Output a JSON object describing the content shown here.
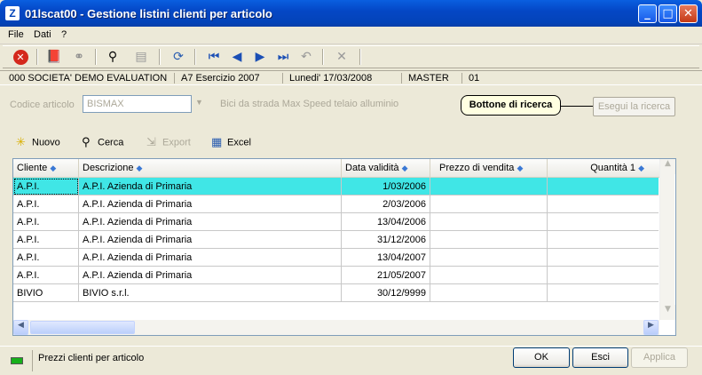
{
  "window": {
    "title": "01lscat00 - Gestione listini clienti per articolo",
    "app_icon_letter": "Z"
  },
  "menu": [
    {
      "label": "File"
    },
    {
      "label": "Dati"
    },
    {
      "label": "?"
    }
  ],
  "toolbar": {
    "icons": [
      "close-red-icon",
      "book-icon",
      "binoculars-icon",
      "find-icon",
      "paste-icon",
      "refresh-icon",
      "first-icon",
      "prev-icon",
      "next-icon",
      "last-icon",
      "undo-icon",
      "delete-icon"
    ]
  },
  "status": {
    "company": "000 SOCIETA' DEMO EVALUATION",
    "year": "A7 Esercizio 2007",
    "date": "Lunedi' 17/03/2008",
    "user": "MASTER",
    "code": "01"
  },
  "search": {
    "label": "Codice articolo",
    "value": "BISMAX",
    "description": "Bici da strada Max Speed telaio alluminio",
    "tooltip": "Bottone di ricerca",
    "button_label": "Esegui la ricerca"
  },
  "actions": {
    "new": "Nuovo",
    "find": "Cerca",
    "export": "Export",
    "excel": "Excel"
  },
  "table": {
    "columns": [
      "Cliente",
      "Descrizione",
      "Data validità",
      "Prezzo di vendita",
      "Quantità 1"
    ],
    "rows": [
      {
        "cliente": "A.P.I.",
        "descrizione": "A.P.I. Azienda di Primaria",
        "data": "1/03/2006",
        "prezzo": "",
        "quantita": ""
      },
      {
        "cliente": "A.P.I.",
        "descrizione": "A.P.I. Azienda di Primaria",
        "data": "2/03/2006",
        "prezzo": "",
        "quantita": ""
      },
      {
        "cliente": "A.P.I.",
        "descrizione": "A.P.I. Azienda di Primaria",
        "data": "13/04/2006",
        "prezzo": "",
        "quantita": ""
      },
      {
        "cliente": "A.P.I.",
        "descrizione": "A.P.I. Azienda di Primaria",
        "data": "31/12/2006",
        "prezzo": "",
        "quantita": ""
      },
      {
        "cliente": "A.P.I.",
        "descrizione": "A.P.I. Azienda di Primaria",
        "data": "13/04/2007",
        "prezzo": "",
        "quantita": ""
      },
      {
        "cliente": "A.P.I.",
        "descrizione": "A.P.I. Azienda di Primaria",
        "data": "21/05/2007",
        "prezzo": "",
        "quantita": ""
      },
      {
        "cliente": "BIVIO",
        "descrizione": "BIVIO s.r.l.",
        "data": "30/12/9999",
        "prezzo": "",
        "quantita": ""
      }
    ],
    "selected_row": 0
  },
  "footer": {
    "message": "Prezzi clienti per articolo",
    "ok": "OK",
    "exit": "Esci",
    "apply": "Applica"
  },
  "colors": {
    "selected_row": "#40e6e6",
    "titlebar": "#0343b8"
  }
}
